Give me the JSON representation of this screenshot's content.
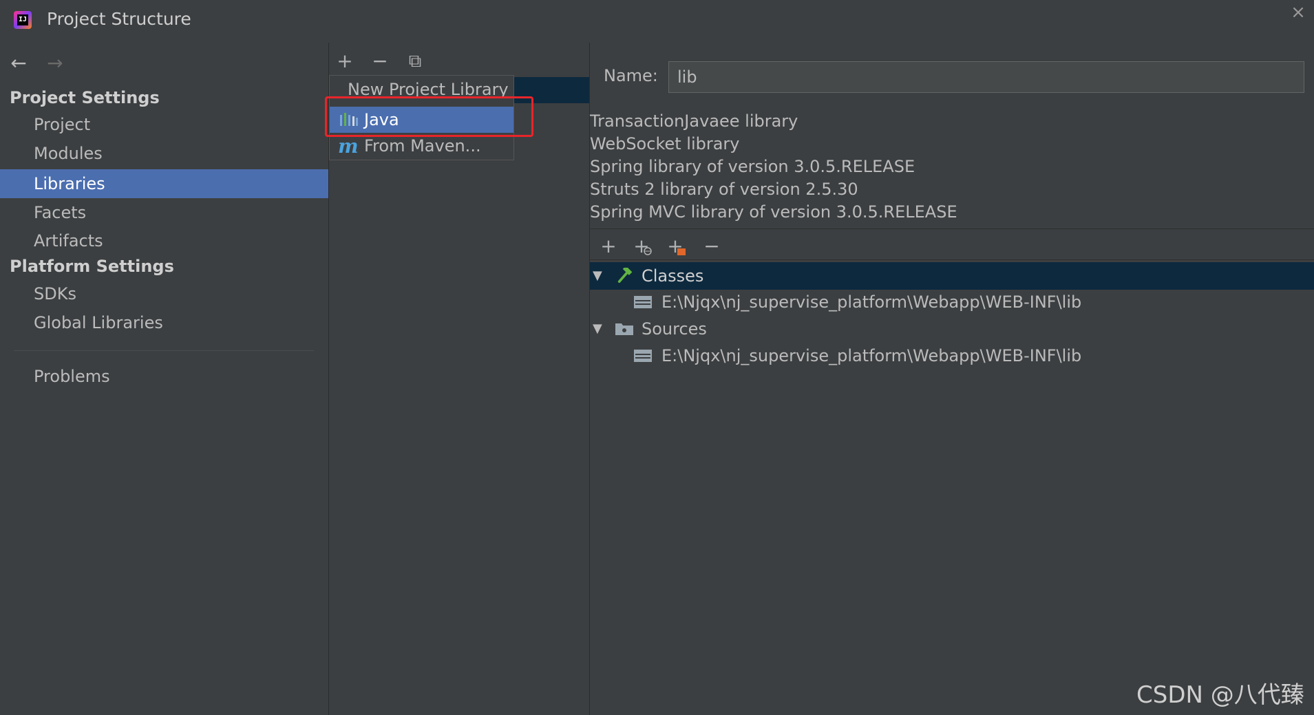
{
  "window": {
    "title": "Project Structure",
    "app_icon_label": "IJ",
    "close_glyph": "×"
  },
  "sidebar": {
    "back_glyph": "←",
    "forward_glyph": "→",
    "project_settings_header": "Project Settings",
    "project_items": [
      {
        "label": "Project"
      },
      {
        "label": "Modules"
      },
      {
        "label": "Libraries",
        "selected": true
      },
      {
        "label": "Facets"
      },
      {
        "label": "Artifacts"
      }
    ],
    "platform_settings_header": "Platform Settings",
    "platform_items": [
      {
        "label": "SDKs"
      },
      {
        "label": "Global Libraries"
      }
    ],
    "problems_label": "Problems"
  },
  "middle": {
    "toolbar": {
      "add": "+",
      "remove": "−",
      "copy": "⧉"
    },
    "popup": {
      "title": "New Project Library",
      "items": [
        {
          "label": "Java",
          "icon": "library-bars-icon",
          "selected": true
        },
        {
          "label": "From Maven...",
          "icon": "maven-icon",
          "icon_glyph": "m"
        }
      ]
    }
  },
  "right": {
    "name_label": "Name:",
    "name_value": "lib",
    "description_lines": [
      "TransactionJavaee library",
      "WebSocket library",
      "Spring library of version 3.0.5.RELEASE",
      "Struts 2 library of version 2.5.30",
      "Spring MVC library of version 3.0.5.RELEASE"
    ],
    "toolbar": {
      "add": "+",
      "add_url": "+",
      "add_alt": "+",
      "remove": "−"
    },
    "tree": {
      "classes_label": "Classes",
      "classes_path": "E:\\Njqx\\nj_supervise_platform\\Webapp\\WEB-INF\\lib",
      "sources_label": "Sources",
      "sources_path": "E:\\Njqx\\nj_supervise_platform\\Webapp\\WEB-INF\\lib",
      "expand_glyph": "▼"
    }
  },
  "watermark": "CSDN @八代臻",
  "colors": {
    "background": "#3c3f41",
    "selection": "#4b6eaf",
    "inactive_selection": "#0d293e",
    "highlight_box": "#e8252a"
  }
}
